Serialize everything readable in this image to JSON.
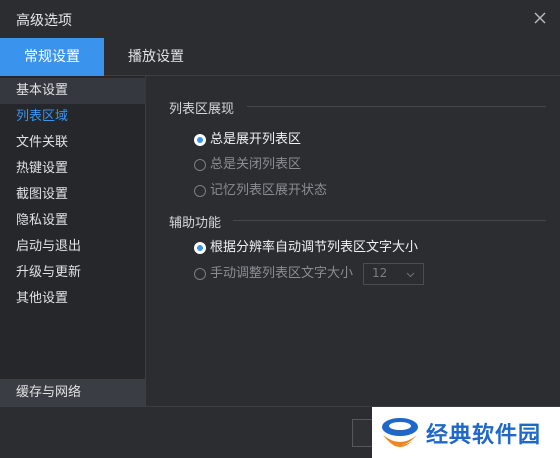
{
  "window": {
    "title": "高级选项",
    "close_icon": "close-icon"
  },
  "tabs": [
    {
      "label": "常规设置",
      "active": true
    },
    {
      "label": "播放设置",
      "active": false
    }
  ],
  "sidebar": {
    "items": [
      {
        "label": "基本设置"
      },
      {
        "label": "列表区域"
      },
      {
        "label": "文件关联"
      },
      {
        "label": "热键设置"
      },
      {
        "label": "截图设置"
      },
      {
        "label": "隐私设置"
      },
      {
        "label": "启动与退出"
      },
      {
        "label": "升级与更新"
      },
      {
        "label": "其他设置"
      }
    ],
    "bottom_item": "缓存与网络"
  },
  "sections": [
    {
      "title": "列表区展现",
      "options": [
        {
          "label": "总是展开列表区",
          "checked": true
        },
        {
          "label": "总是关闭列表区",
          "checked": false
        },
        {
          "label": "记忆列表区展开状态",
          "checked": false
        }
      ]
    },
    {
      "title": "辅助功能",
      "options": [
        {
          "label": "根据分辨率自动调节列表区文字大小",
          "checked": true
        },
        {
          "label": "手动调整列表区文字大小",
          "checked": false
        }
      ]
    }
  ],
  "font_size_select": {
    "value": "12"
  },
  "watermark": {
    "text": "经典软件园"
  },
  "colors": {
    "accent": "#3a94ee",
    "background": "#2b2d31",
    "sidebar": "#25272b"
  }
}
